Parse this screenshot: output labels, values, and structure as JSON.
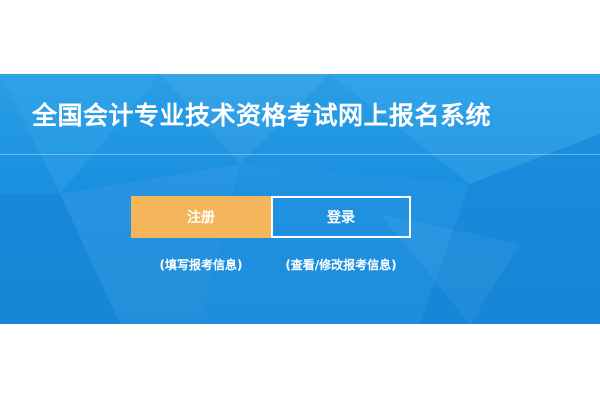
{
  "header": {
    "title": "全国会计专业技术资格考试网上报名系统"
  },
  "actions": {
    "register_label": "注册",
    "register_hint": "(填写报考信息)",
    "login_label": "登录",
    "login_hint": "(查看/修改报考信息)"
  },
  "colors": {
    "banner_blue": "#1b8fe0",
    "register_orange": "#f5b55a",
    "text_white": "#ffffff"
  }
}
